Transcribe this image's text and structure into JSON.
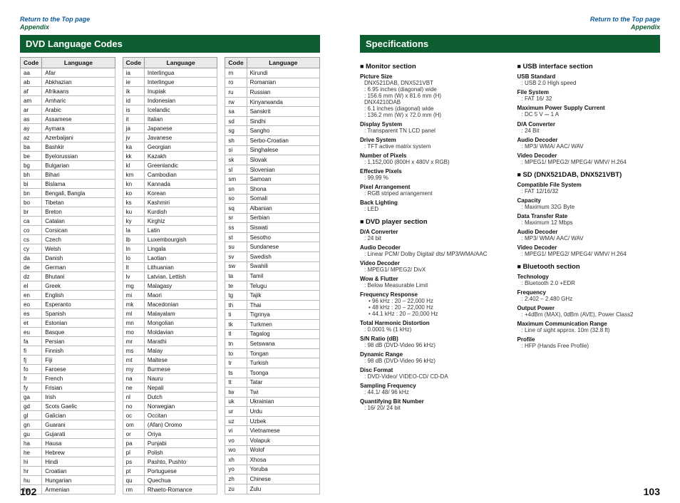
{
  "nav": {
    "return": "Return to the Top page",
    "appendix": "Appendix"
  },
  "headings": {
    "dvd": "DVD Language Codes",
    "spec": "Specifications"
  },
  "tableHeaders": {
    "code": "Code",
    "lang": "Language"
  },
  "pageNums": {
    "left": "102",
    "right": "103"
  },
  "langCol1": [
    [
      "aa",
      "Afar"
    ],
    [
      "ab",
      "Abkhazian"
    ],
    [
      "af",
      "Afrikaans"
    ],
    [
      "am",
      "Amharic"
    ],
    [
      "ar",
      "Arabic"
    ],
    [
      "as",
      "Assamese"
    ],
    [
      "ay",
      "Aymara"
    ],
    [
      "az",
      "Azerbaijani"
    ],
    [
      "ba",
      "Bashkir"
    ],
    [
      "be",
      "Byelorussian"
    ],
    [
      "bg",
      "Bulgarian"
    ],
    [
      "bh",
      "Bihari"
    ],
    [
      "bi",
      "Bislama"
    ],
    [
      "bn",
      "Bengali, Bangla"
    ],
    [
      "bo",
      "Tibetan"
    ],
    [
      "br",
      "Breton"
    ],
    [
      "ca",
      "Catalan"
    ],
    [
      "co",
      "Corsican"
    ],
    [
      "cs",
      "Czech"
    ],
    [
      "cy",
      "Welsh"
    ],
    [
      "da",
      "Danish"
    ],
    [
      "de",
      "German"
    ],
    [
      "dz",
      "Bhutani"
    ],
    [
      "el",
      "Greek"
    ],
    [
      "en",
      "English"
    ],
    [
      "eo",
      "Esperanto"
    ],
    [
      "es",
      "Spanish"
    ],
    [
      "et",
      "Estonian"
    ],
    [
      "eu",
      "Basque"
    ],
    [
      "fa",
      "Persian"
    ],
    [
      "fi",
      "Finnish"
    ],
    [
      "fj",
      "Fiji"
    ],
    [
      "fo",
      "Faroese"
    ],
    [
      "fr",
      "French"
    ],
    [
      "fy",
      "Frisian"
    ],
    [
      "ga",
      "Irish"
    ],
    [
      "gd",
      "Scots Gaelic"
    ],
    [
      "gl",
      "Galician"
    ],
    [
      "gn",
      "Guarani"
    ],
    [
      "gu",
      "Gujarati"
    ],
    [
      "ha",
      "Hausa"
    ],
    [
      "he",
      "Hebrew"
    ],
    [
      "hi",
      "Hindi"
    ],
    [
      "hr",
      "Croatian"
    ],
    [
      "hu",
      "Hungarian"
    ],
    [
      "hy",
      "Armenian"
    ]
  ],
  "langCol2": [
    [
      "ia",
      "Interlingua"
    ],
    [
      "ie",
      "Interlingue"
    ],
    [
      "ik",
      "Inupiak"
    ],
    [
      "id",
      "Indonesian"
    ],
    [
      "is",
      "Icelandic"
    ],
    [
      "it",
      "Italian"
    ],
    [
      "ja",
      "Japanese"
    ],
    [
      "jv",
      "Javanese"
    ],
    [
      "ka",
      "Georgian"
    ],
    [
      "kk",
      "Kazakh"
    ],
    [
      "kl",
      "Greenlandic"
    ],
    [
      "km",
      "Cambodian"
    ],
    [
      "kn",
      "Kannada"
    ],
    [
      "ko",
      "Korean"
    ],
    [
      "ks",
      "Kashmiri"
    ],
    [
      "ku",
      "Kurdish"
    ],
    [
      "ky",
      "Kirghiz"
    ],
    [
      "la",
      "Latin"
    ],
    [
      "lb",
      "Luxembourgish"
    ],
    [
      "ln",
      "Lingala"
    ],
    [
      "lo",
      "Laotian"
    ],
    [
      "lt",
      "Lithuanian"
    ],
    [
      "lv",
      "Latvian, Lettish"
    ],
    [
      "mg",
      "Malagasy"
    ],
    [
      "mi",
      "Maori"
    ],
    [
      "mk",
      "Macedonian"
    ],
    [
      "ml",
      "Malayalam"
    ],
    [
      "mn",
      "Mongolian"
    ],
    [
      "mo",
      "Moldavian"
    ],
    [
      "mr",
      "Marathi"
    ],
    [
      "ms",
      "Malay"
    ],
    [
      "mt",
      "Maltese"
    ],
    [
      "my",
      "Burmese"
    ],
    [
      "na",
      "Nauru"
    ],
    [
      "ne",
      "Nepali"
    ],
    [
      "nl",
      "Dutch"
    ],
    [
      "no",
      "Norwegian"
    ],
    [
      "oc",
      "Occitan"
    ],
    [
      "om",
      "(Afan) Oromo"
    ],
    [
      "or",
      "Oriya"
    ],
    [
      "pa",
      "Punjabi"
    ],
    [
      "pl",
      "Polish"
    ],
    [
      "ps",
      "Pashto, Pushto"
    ],
    [
      "pt",
      "Portuguese"
    ],
    [
      "qu",
      "Quechua"
    ],
    [
      "rm",
      "Rhaeto-Romance"
    ]
  ],
  "langCol3": [
    [
      "rn",
      "Kirundi"
    ],
    [
      "ro",
      "Romanian"
    ],
    [
      "ru",
      "Russian"
    ],
    [
      "rw",
      "Kinyarwanda"
    ],
    [
      "sa",
      "Sanskrit"
    ],
    [
      "sd",
      "Sindhi"
    ],
    [
      "sg",
      "Sangho"
    ],
    [
      "sh",
      "Serbo-Croatian"
    ],
    [
      "si",
      "Singhalese"
    ],
    [
      "sk",
      "Slovak"
    ],
    [
      "sl",
      "Slovenian"
    ],
    [
      "sm",
      "Samoan"
    ],
    [
      "sn",
      "Shona"
    ],
    [
      "so",
      "Somali"
    ],
    [
      "sq",
      "Albanian"
    ],
    [
      "sr",
      "Serbian"
    ],
    [
      "ss",
      "Siswati"
    ],
    [
      "st",
      "Sesotho"
    ],
    [
      "su",
      "Sundanese"
    ],
    [
      "sv",
      "Swedish"
    ],
    [
      "sw",
      "Swahili"
    ],
    [
      "ta",
      "Tamil"
    ],
    [
      "te",
      "Telugu"
    ],
    [
      "tg",
      "Tajik"
    ],
    [
      "th",
      "Thai"
    ],
    [
      "ti",
      "Tigrinya"
    ],
    [
      "tk",
      "Turkmen"
    ],
    [
      "tl",
      "Tagalog"
    ],
    [
      "tn",
      "Setswana"
    ],
    [
      "to",
      "Tongan"
    ],
    [
      "tr",
      "Turkish"
    ],
    [
      "ts",
      "Tsonga"
    ],
    [
      "tt",
      "Tatar"
    ],
    [
      "tw",
      "Twi"
    ],
    [
      "uk",
      "Ukrainian"
    ],
    [
      "ur",
      "Urdu"
    ],
    [
      "uz",
      "Uzbek"
    ],
    [
      "vi",
      "Vietnamese"
    ],
    [
      "vo",
      "Volapuk"
    ],
    [
      "wo",
      "Wolof"
    ],
    [
      "xh",
      "Xhosa"
    ],
    [
      "yo",
      "Yoruba"
    ],
    [
      "zh",
      "Chinese"
    ],
    [
      "zu",
      "Zulu"
    ]
  ],
  "specLeft": [
    {
      "type": "sec",
      "t": "Monitor section"
    },
    {
      "type": "item",
      "l": "Picture Size",
      "subs": [
        "DNX521DAB, DNX521VBT",
        ": 6.95 inches (diagonal) wide",
        ": 156.6 mm (W) x 81.6 mm (H)",
        "DNX4210DAB",
        ": 6.1 inches (diagonal) wide",
        ": 136.2 mm (W) x 72.0 mm (H)"
      ]
    },
    {
      "type": "item",
      "l": "Display System",
      "v": "Transparent TN LCD panel"
    },
    {
      "type": "item",
      "l": "Drive System",
      "v": "TFT active matrix system"
    },
    {
      "type": "item",
      "l": "Number of Pixels",
      "v": "1,152,000 (800H x 480V x RGB)"
    },
    {
      "type": "item",
      "l": "Effective Pixels",
      "v": "99.99 %"
    },
    {
      "type": "item",
      "l": "Pixel Arrangement",
      "v": "RGB striped arrangement"
    },
    {
      "type": "item",
      "l": "Back Lighting",
      "v": "LED"
    },
    {
      "type": "sec",
      "t": "DVD player section"
    },
    {
      "type": "item",
      "l": "D/A Converter",
      "v": "24 bit"
    },
    {
      "type": "item",
      "l": "Audio Decoder",
      "v": "Linear PCM/ Dolby Digital/ dts/ MP3/WMA/AAC"
    },
    {
      "type": "item",
      "l": "Video Decoder",
      "v": "MPEG1/ MPEG2/ DivX"
    },
    {
      "type": "item",
      "l": "Wow & Flutter",
      "v": "Below Measurable Limit"
    },
    {
      "type": "item",
      "l": "Frequency Response",
      "bul": [
        "96 kHz : 20 – 22,000 Hz",
        "48 kHz : 20 – 22,000 Hz",
        "44.1 kHz : 20 – 20,000 Hz"
      ]
    },
    {
      "type": "item",
      "l": "Total Harmonic Distortion",
      "v": "0.0001 % (1 kHz)"
    },
    {
      "type": "item",
      "l": "S/N Ratio (dB)",
      "v": "98 dB (DVD-Video 96 kHz)"
    },
    {
      "type": "item",
      "l": "Dynamic Range",
      "v": "98 dB (DVD-Video 96 kHz)"
    },
    {
      "type": "item",
      "l": "Disc Format",
      "v": "DVD-Video/ VIDEO-CD/ CD-DA"
    },
    {
      "type": "item",
      "l": "Sampling Frequency",
      "v": "44.1/ 48/ 96 kHz"
    },
    {
      "type": "item",
      "l": "Quantifying Bit Number",
      "v": "16/ 20/ 24 bit"
    }
  ],
  "specRight": [
    {
      "type": "sec",
      "t": "USB interface section"
    },
    {
      "type": "item",
      "l": "USB Standard",
      "v": "USB 2.0 High speed"
    },
    {
      "type": "item",
      "l": "File System",
      "v": "FAT 16/ 32"
    },
    {
      "type": "item",
      "l": "Maximum Power Supply Current",
      "v": "DC 5 V ⎓ 1 A"
    },
    {
      "type": "item",
      "l": "D/A Converter",
      "v": "24 Bit"
    },
    {
      "type": "item",
      "l": "Audio Decoder",
      "v": "MP3/ WMA/ AAC/ WAV"
    },
    {
      "type": "item",
      "l": "Video Decoder",
      "v": "MPEG1/ MPEG2/ MPEG4/ WMV/ H.264"
    },
    {
      "type": "sec",
      "t": "SD (DNX521DAB, DNX521VBT)"
    },
    {
      "type": "item",
      "l": "Compatible File System",
      "v": "FAT 12/16/32"
    },
    {
      "type": "item",
      "l": "Capacity",
      "v": "Maximum 32G Byte"
    },
    {
      "type": "item",
      "l": "Data Transfer Rate",
      "v": "Maximum 12 Mbps"
    },
    {
      "type": "item",
      "l": "Audio Decoder",
      "v": "MP3/ WMA/ AAC/ WAV"
    },
    {
      "type": "item",
      "l": "Video Decoder",
      "v": "MPEG1/ MPEG2/ MPEG4/ WMV/ H.264"
    },
    {
      "type": "sec",
      "t": "Bluetooth section"
    },
    {
      "type": "item",
      "l": "Technology",
      "v": "Bluetooth 2.0 +EDR"
    },
    {
      "type": "item",
      "l": "Frequency",
      "v": "2.402 – 2.480 GHz"
    },
    {
      "type": "item",
      "l": "Output Power",
      "v": "+4dBm (MAX), 0dBm (AVE), Power Class2"
    },
    {
      "type": "item",
      "l": "Maximum Communication Range",
      "v": "Line of sight approx. 10m (32.8 ft)"
    },
    {
      "type": "item",
      "l": "Profile",
      "v": "HFP (Hands Free Profile)"
    }
  ]
}
